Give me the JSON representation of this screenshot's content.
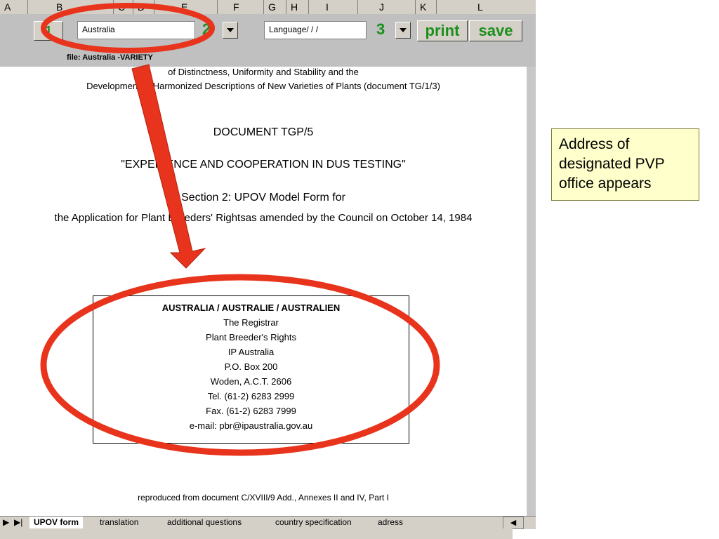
{
  "columns": [
    "A",
    "B",
    "C",
    "D",
    "E",
    "F",
    "G",
    "H",
    "I",
    "J",
    "K",
    "L"
  ],
  "toolbar": {
    "left_button": "1",
    "country_value": "Australia",
    "num2": "2",
    "language_value": "Language/ / /",
    "num3": "3",
    "print_label": "print",
    "save_label": "save"
  },
  "file_label": "file:  Australia -VARIETY",
  "doc": {
    "line1": "of Distinctness, Uniformity and Stability and the",
    "line2": "Development of Harmonized Descriptions of New Varieties of Plants (document TG/1/3)",
    "line3": "DOCUMENT TGP/5",
    "line4": "\"EXPERIENCE AND COOPERATION IN DUS TESTING\"",
    "line5": "Section 2: UPOV Model Form for",
    "line6": "the Application for Plant Breeders' Rightsas amended by the Council on October 14, 1984",
    "footer": "reproduced from document C/XVIII/9 Add., Annexes II and IV, Part I"
  },
  "address": {
    "title": "AUSTRALIA / AUSTRALIE / AUSTRALIEN",
    "lines": [
      "The Registrar",
      "Plant Breeder's Rights",
      "IP Australia",
      "P.O. Box 200",
      "Woden, A.C.T. 2606",
      "Tel. (61-2) 6283 2999",
      "Fax. (61-2) 6283 7999",
      "e-mail: pbr@ipaustralia.gov.au"
    ]
  },
  "callout": "Address of designated PVP office appears",
  "tabs": [
    "UPOV form",
    "translation",
    "additional questions",
    "country specification",
    "adress"
  ],
  "colors": {
    "annotation": "#e8341c",
    "green": "#1a8f1a"
  }
}
